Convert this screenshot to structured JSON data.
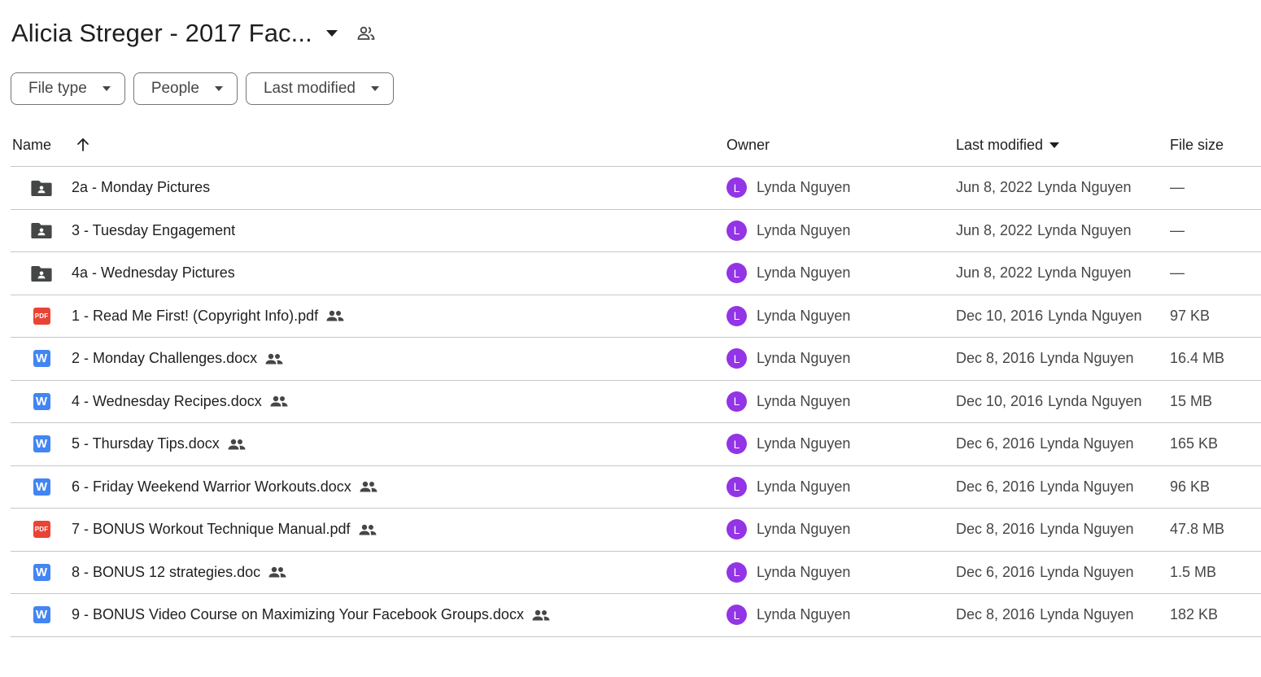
{
  "header": {
    "title": "Alicia Streger - 2017 Fac..."
  },
  "filters": [
    {
      "label": "File type"
    },
    {
      "label": "People"
    },
    {
      "label": "Last modified"
    }
  ],
  "columns": {
    "name": "Name",
    "owner": "Owner",
    "last_modified": "Last modified",
    "file_size": "File size"
  },
  "rows": [
    {
      "type": "shared-folder",
      "icon": "shared-folder-icon",
      "name": "2a - Monday Pictures",
      "shared": false,
      "owner_initial": "L",
      "owner": "Lynda Nguyen",
      "date": "Jun 8, 2022",
      "modified_by": "Lynda Nguyen",
      "size": "—"
    },
    {
      "type": "shared-folder",
      "icon": "shared-folder-icon",
      "name": "3 - Tuesday Engagement",
      "shared": false,
      "owner_initial": "L",
      "owner": "Lynda Nguyen",
      "date": "Jun 8, 2022",
      "modified_by": "Lynda Nguyen",
      "size": "—"
    },
    {
      "type": "shared-folder",
      "icon": "shared-folder-icon",
      "name": "4a - Wednesday Pictures",
      "shared": false,
      "owner_initial": "L",
      "owner": "Lynda Nguyen",
      "date": "Jun 8, 2022",
      "modified_by": "Lynda Nguyen",
      "size": "—"
    },
    {
      "type": "pdf",
      "icon": "pdf-icon",
      "icon_text": "PDF",
      "name": "1 - Read Me First! (Copyright Info).pdf",
      "shared": true,
      "owner_initial": "L",
      "owner": "Lynda Nguyen",
      "date": "Dec 10, 2016",
      "modified_by": "Lynda Nguyen",
      "size": "97 KB"
    },
    {
      "type": "word",
      "icon": "word-icon",
      "icon_text": "W",
      "name": "2 - Monday Challenges.docx",
      "shared": true,
      "owner_initial": "L",
      "owner": "Lynda Nguyen",
      "date": "Dec 8, 2016",
      "modified_by": "Lynda Nguyen",
      "size": "16.4 MB"
    },
    {
      "type": "word",
      "icon": "word-icon",
      "icon_text": "W",
      "name": "4 - Wednesday Recipes.docx",
      "shared": true,
      "owner_initial": "L",
      "owner": "Lynda Nguyen",
      "date": "Dec 10, 2016",
      "modified_by": "Lynda Nguyen",
      "size": "15 MB"
    },
    {
      "type": "word",
      "icon": "word-icon",
      "icon_text": "W",
      "name": "5 - Thursday Tips.docx",
      "shared": true,
      "owner_initial": "L",
      "owner": "Lynda Nguyen",
      "date": "Dec 6, 2016",
      "modified_by": "Lynda Nguyen",
      "size": "165 KB"
    },
    {
      "type": "word",
      "icon": "word-icon",
      "icon_text": "W",
      "name": "6 - Friday Weekend Warrior Workouts.docx",
      "shared": true,
      "owner_initial": "L",
      "owner": "Lynda Nguyen",
      "date": "Dec 6, 2016",
      "modified_by": "Lynda Nguyen",
      "size": "96 KB"
    },
    {
      "type": "pdf",
      "icon": "pdf-icon",
      "icon_text": "PDF",
      "name": "7 - BONUS Workout Technique Manual.pdf",
      "shared": true,
      "owner_initial": "L",
      "owner": "Lynda Nguyen",
      "date": "Dec 8, 2016",
      "modified_by": "Lynda Nguyen",
      "size": "47.8 MB"
    },
    {
      "type": "word",
      "icon": "word-icon",
      "icon_text": "W",
      "name": "8 - BONUS 12 strategies.doc",
      "shared": true,
      "owner_initial": "L",
      "owner": "Lynda Nguyen",
      "date": "Dec 6, 2016",
      "modified_by": "Lynda Nguyen",
      "size": "1.5 MB"
    },
    {
      "type": "word",
      "icon": "word-icon",
      "icon_text": "W",
      "name": "9 - BONUS Video Course on Maximizing Your Facebook Groups.docx",
      "shared": true,
      "owner_initial": "L",
      "owner": "Lynda Nguyen",
      "date": "Dec 8, 2016",
      "modified_by": "Lynda Nguyen",
      "size": "182 KB"
    }
  ],
  "colors": {
    "avatar": "#9334e6",
    "pdf": "#ea4335",
    "word": "#4285f4",
    "folder": "#444746",
    "divider": "#c7c7c7"
  }
}
